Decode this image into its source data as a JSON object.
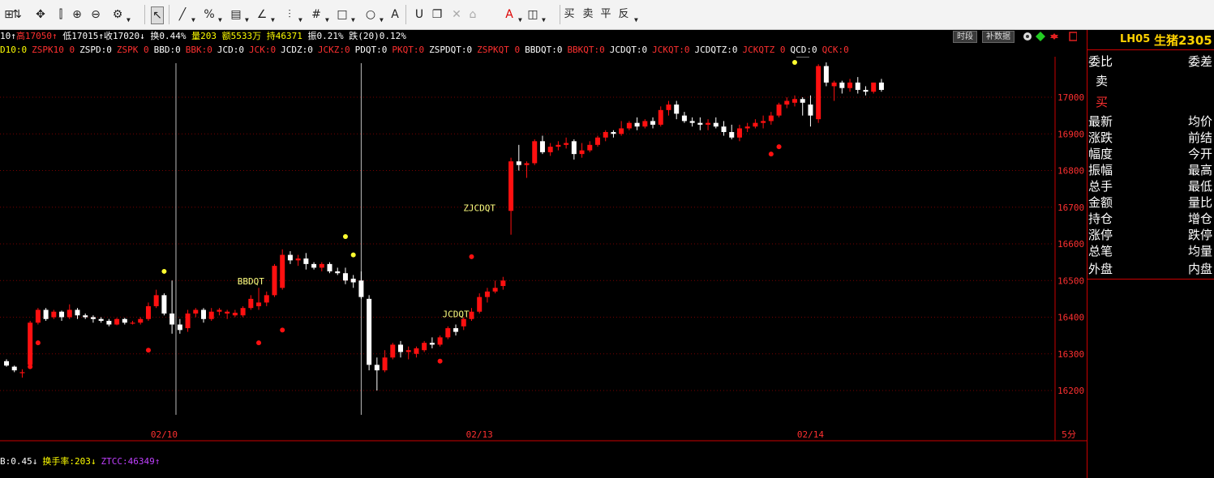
{
  "toolbar": {
    "icons": [
      "grid-icon",
      "properties-icon",
      "move-icon",
      "ruler-icon",
      "zoom-in-icon",
      "zoom-out-icon",
      "settings-icon",
      "cursor-icon",
      "line-icon",
      "percent-icon",
      "grid-ruler-icon",
      "angle-icon",
      "parallel-icon",
      "fib-grid-icon",
      "rectangle-icon",
      "circle-icon",
      "text-icon",
      "magnet-icon",
      "copy-icon",
      "delete-icon",
      "lock-icon",
      "color-icon",
      "save-icon"
    ],
    "actions": [
      "买",
      "卖",
      "平",
      "反"
    ]
  },
  "info1": {
    "prefix": "10↑",
    "high": "高17050↑",
    "low": "低17015↑",
    "close": "收17020↓",
    "turnover": "换0.44%",
    "volume": "量203",
    "amount": "额5533万",
    "hold": "持46371",
    "amplitude": "振0.21%",
    "fall": "跌(20)0.12%"
  },
  "buttons": {
    "period": "时段",
    "fill": "补数据"
  },
  "info2": [
    {
      "t": "D10:0",
      "c": "yel"
    },
    {
      "t": "ZSPK10 0",
      "c": "red"
    },
    {
      "t": "ZSPD:0",
      "c": "wht"
    },
    {
      "t": "ZSPK 0",
      "c": "red"
    },
    {
      "t": "BBD:0",
      "c": "wht"
    },
    {
      "t": "BBK:0",
      "c": "red"
    },
    {
      "t": "JCD:0",
      "c": "wht"
    },
    {
      "t": "JCK:0",
      "c": "red"
    },
    {
      "t": "JCDZ:0",
      "c": "wht"
    },
    {
      "t": "JCKZ:0",
      "c": "red"
    },
    {
      "t": "PDQT:0",
      "c": "wht"
    },
    {
      "t": "PKQT:0",
      "c": "red"
    },
    {
      "t": "ZSPDQT:0",
      "c": "wht"
    },
    {
      "t": "ZSPKQT 0",
      "c": "red"
    },
    {
      "t": "BBDQT:0",
      "c": "wht"
    },
    {
      "t": "BBKQT:0",
      "c": "red"
    },
    {
      "t": "JCDQT:0",
      "c": "wht"
    },
    {
      "t": "JCKQT:0",
      "c": "red"
    },
    {
      "t": "JCDQTZ:0",
      "c": "wht"
    },
    {
      "t": "JCKQTZ 0",
      "c": "red"
    },
    {
      "t": "QCD:0",
      "c": "wht"
    },
    {
      "t": "QCK:0",
      "c": "red"
    }
  ],
  "chart_data": {
    "type": "candlestick",
    "period_label": "5分",
    "y_ticks": [
      16200,
      16300,
      16400,
      16500,
      16600,
      16700,
      16800,
      16900,
      17000
    ],
    "x_labels": [
      {
        "label": "02/10",
        "index": 20
      },
      {
        "label": "02/13",
        "index": 60
      },
      {
        "label": "02/14",
        "index": 102
      }
    ],
    "session_dividers": [
      21.5,
      45
    ],
    "high_marker": {
      "label": "17095",
      "index": 100
    },
    "annotations": [
      {
        "text": "BBDQT",
        "index": 31,
        "value": 16490
      },
      {
        "text": "ZJCDQT",
        "index": 60,
        "value": 16690
      },
      {
        "text": "JCDQT",
        "index": 57,
        "value": 16400
      }
    ],
    "dots_red": [
      [
        3,
        16265
      ],
      [
        4,
        16330
      ],
      [
        18,
        16310
      ],
      [
        32,
        16330
      ],
      [
        35,
        16365
      ],
      [
        55,
        16280
      ],
      [
        59,
        16565
      ],
      [
        97,
        16845
      ],
      [
        98,
        16865
      ]
    ],
    "dots_yellow": [
      [
        20,
        16525
      ],
      [
        43,
        16620
      ],
      [
        44,
        16570
      ],
      [
        100,
        17095
      ]
    ],
    "candles": [
      [
        16280,
        16285,
        16265,
        16268
      ],
      [
        16265,
        16268,
        16250,
        16255
      ],
      [
        16250,
        16258,
        16235,
        16250
      ],
      [
        16270,
        16390,
        16268,
        16385
      ],
      [
        16385,
        16425,
        16380,
        16420
      ],
      [
        16420,
        16425,
        16390,
        16395
      ],
      [
        16400,
        16420,
        16395,
        16415
      ],
      [
        16415,
        16418,
        16390,
        16400
      ],
      [
        16400,
        16435,
        16395,
        16420
      ],
      [
        16420,
        16425,
        16395,
        16405
      ],
      [
        16405,
        16410,
        16395,
        16400
      ],
      [
        16400,
        16405,
        16385,
        16395
      ],
      [
        16395,
        16400,
        16385,
        16390
      ],
      [
        16390,
        16395,
        16375,
        16380
      ],
      [
        16380,
        16398,
        16378,
        16395
      ],
      [
        16395,
        16398,
        16380,
        16385
      ],
      [
        16385,
        16390,
        16380,
        16385
      ],
      [
        16385,
        16400,
        16380,
        16395
      ],
      [
        16395,
        16440,
        16390,
        16430
      ],
      [
        16430,
        16475,
        16425,
        16460
      ],
      [
        16460,
        16465,
        16405,
        16410
      ],
      [
        16410,
        16500,
        16355,
        16380
      ],
      [
        16380,
        16395,
        16355,
        16365
      ],
      [
        16370,
        16420,
        16360,
        16410
      ],
      [
        16410,
        16425,
        16400,
        16420
      ],
      [
        16420,
        16425,
        16385,
        16395
      ],
      [
        16395,
        16425,
        16390,
        16415
      ],
      [
        16415,
        16425,
        16405,
        16420
      ],
      [
        16410,
        16420,
        16395,
        16415
      ],
      [
        16405,
        16420,
        16400,
        16412
      ],
      [
        16405,
        16430,
        16400,
        16425
      ],
      [
        16425,
        16460,
        16420,
        16450
      ],
      [
        16430,
        16480,
        16420,
        16440
      ],
      [
        16440,
        16470,
        16430,
        16460
      ],
      [
        16460,
        16545,
        16455,
        16540
      ],
      [
        16480,
        16585,
        16475,
        16570
      ],
      [
        16570,
        16580,
        16545,
        16555
      ],
      [
        16555,
        16570,
        16540,
        16560
      ],
      [
        16560,
        16575,
        16530,
        16545
      ],
      [
        16545,
        16550,
        16530,
        16535
      ],
      [
        16535,
        16550,
        16525,
        16545
      ],
      [
        16545,
        16550,
        16520,
        16525
      ],
      [
        16525,
        16535,
        16515,
        16520
      ],
      [
        16520,
        16535,
        16490,
        16500
      ],
      [
        16505,
        16515,
        16480,
        16495
      ],
      [
        16500,
        16525,
        16450,
        16455
      ],
      [
        16450,
        16460,
        16255,
        16270
      ],
      [
        16270,
        16290,
        16200,
        16255
      ],
      [
        16255,
        16310,
        16250,
        16290
      ],
      [
        16290,
        16330,
        16285,
        16325
      ],
      [
        16325,
        16335,
        16290,
        16305
      ],
      [
        16305,
        16320,
        16285,
        16310
      ],
      [
        16300,
        16320,
        16290,
        16315
      ],
      [
        16310,
        16335,
        16305,
        16330
      ],
      [
        16330,
        16345,
        16315,
        16325
      ],
      [
        16325,
        16350,
        16320,
        16345
      ],
      [
        16345,
        16375,
        16340,
        16370
      ],
      [
        16370,
        16380,
        16350,
        16360
      ],
      [
        16375,
        16400,
        16365,
        16395
      ],
      [
        16395,
        16425,
        16390,
        16415
      ],
      [
        16415,
        16465,
        16410,
        16455
      ],
      [
        16455,
        16480,
        16440,
        16470
      ],
      [
        16470,
        16500,
        16465,
        16480
      ],
      [
        16485,
        16510,
        16475,
        16500
      ],
      [
        16690,
        16835,
        16625,
        16825
      ],
      [
        16825,
        16870,
        16800,
        16815
      ],
      [
        16815,
        16825,
        16780,
        16820
      ],
      [
        16820,
        16885,
        16815,
        16880
      ],
      [
        16880,
        16895,
        16845,
        16850
      ],
      [
        16850,
        16875,
        16840,
        16865
      ],
      [
        16865,
        16880,
        16855,
        16870
      ],
      [
        16870,
        16890,
        16860,
        16875
      ],
      [
        16880,
        16885,
        16830,
        16845
      ],
      [
        16845,
        16875,
        16835,
        16855
      ],
      [
        16855,
        16880,
        16850,
        16870
      ],
      [
        16870,
        16895,
        16865,
        16890
      ],
      [
        16890,
        16910,
        16880,
        16905
      ],
      [
        16905,
        16910,
        16890,
        16900
      ],
      [
        16900,
        16935,
        16895,
        16915
      ],
      [
        16915,
        16935,
        16910,
        16930
      ],
      [
        16930,
        16945,
        16910,
        16920
      ],
      [
        16920,
        16940,
        16915,
        16935
      ],
      [
        16935,
        16945,
        16915,
        16925
      ],
      [
        16925,
        16975,
        16920,
        16965
      ],
      [
        16965,
        16990,
        16950,
        16980
      ],
      [
        16980,
        16990,
        16940,
        16955
      ],
      [
        16950,
        16960,
        16930,
        16935
      ],
      [
        16935,
        16945,
        16920,
        16930
      ],
      [
        16930,
        16945,
        16910,
        16925
      ],
      [
        16925,
        16940,
        16910,
        16930
      ],
      [
        16930,
        16945,
        16915,
        16920
      ],
      [
        16920,
        16935,
        16895,
        16905
      ],
      [
        16905,
        16925,
        16885,
        16890
      ],
      [
        16890,
        16925,
        16880,
        16915
      ],
      [
        16915,
        16930,
        16905,
        16920
      ],
      [
        16920,
        16940,
        16915,
        16930
      ],
      [
        16930,
        16950,
        16915,
        16935
      ],
      [
        16935,
        16960,
        16925,
        16950
      ],
      [
        16950,
        16985,
        16945,
        16980
      ],
      [
        16980,
        17000,
        16970,
        16990
      ],
      [
        16985,
        17005,
        16975,
        16995
      ],
      [
        16995,
        17000,
        16950,
        16985
      ],
      [
        16980,
        17005,
        16920,
        16950
      ],
      [
        16940,
        17090,
        16930,
        17085
      ],
      [
        17085,
        17095,
        17030,
        17040
      ],
      [
        17030,
        17045,
        16990,
        17040
      ],
      [
        17040,
        17045,
        17010,
        17025
      ],
      [
        17025,
        17050,
        17015,
        17040
      ],
      [
        17040,
        17055,
        17010,
        17020
      ],
      [
        17020,
        17030,
        17005,
        17015
      ],
      [
        17015,
        17040,
        17010,
        17040
      ],
      [
        17040,
        17050,
        17015,
        17020
      ]
    ]
  },
  "bottom": [
    {
      "t": "B:0.45↓",
      "c": "wht"
    },
    {
      "t": "换手率:203↓",
      "c": "yel"
    },
    {
      "t": "ZTCC:46349↑",
      "c": "mag"
    }
  ],
  "side": {
    "code": "LH05",
    "name": "生猪2305",
    "rows": [
      [
        "委比",
        "委差"
      ],
      [
        "卖",
        ""
      ],
      [
        "买",
        ""
      ],
      [
        "最新",
        "均价"
      ],
      [
        "涨跌",
        "前结"
      ],
      [
        "幅度",
        "今开"
      ],
      [
        "振幅",
        "最高"
      ],
      [
        "总手",
        "最低"
      ],
      [
        "金额",
        "量比"
      ],
      [
        "持仓",
        "增仓"
      ],
      [
        "涨停",
        "跌停"
      ],
      [
        "总笔",
        "均量"
      ],
      [
        "外盘",
        "内盘"
      ]
    ]
  }
}
